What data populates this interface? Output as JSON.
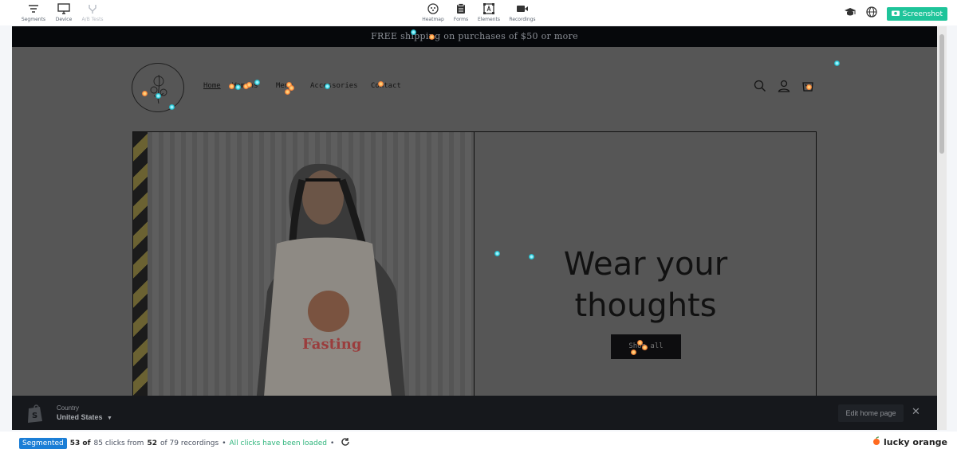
{
  "toolbar": {
    "left_tools": [
      {
        "label": "Segments",
        "icon": "filter-lines-icon"
      },
      {
        "label": "Device",
        "icon": "monitor-icon"
      },
      {
        "label": "A/B Tests",
        "icon": "ab-branch-icon",
        "disabled": true
      }
    ],
    "center_tools": [
      {
        "label": "Heatmap",
        "icon": "heatmap-icon"
      },
      {
        "label": "Forms",
        "icon": "clipboard-icon"
      },
      {
        "label": "Elements",
        "icon": "elements-icon"
      },
      {
        "label": "Recordings",
        "icon": "video-camera-icon"
      }
    ],
    "screenshot_label": "Screenshot",
    "accent_color": "#1ec49a"
  },
  "site": {
    "announcement": "FREE shipping on purchases of $50 or more",
    "nav": [
      "Home",
      "Womens",
      "Mens",
      "Accessories",
      "Contact"
    ],
    "hero_title_line1": "Wear your",
    "hero_title_line2": "thoughts",
    "shop_button": "Shop all",
    "shirt_text": "Fasting"
  },
  "preview_bar": {
    "country_label": "Country",
    "country_value": "United States",
    "edit_button": "Edit home page"
  },
  "status": {
    "segmented_badge": "Segmented",
    "clicks_count": "53 of",
    "clicks_total_text": "85 clicks from",
    "recordings_count": "52",
    "recordings_total_text": "of 79 recordings",
    "separator": "•",
    "loaded_text": "All clicks have been loaded",
    "brand": "lucky orange",
    "brand_color": "#ff6a1f"
  }
}
